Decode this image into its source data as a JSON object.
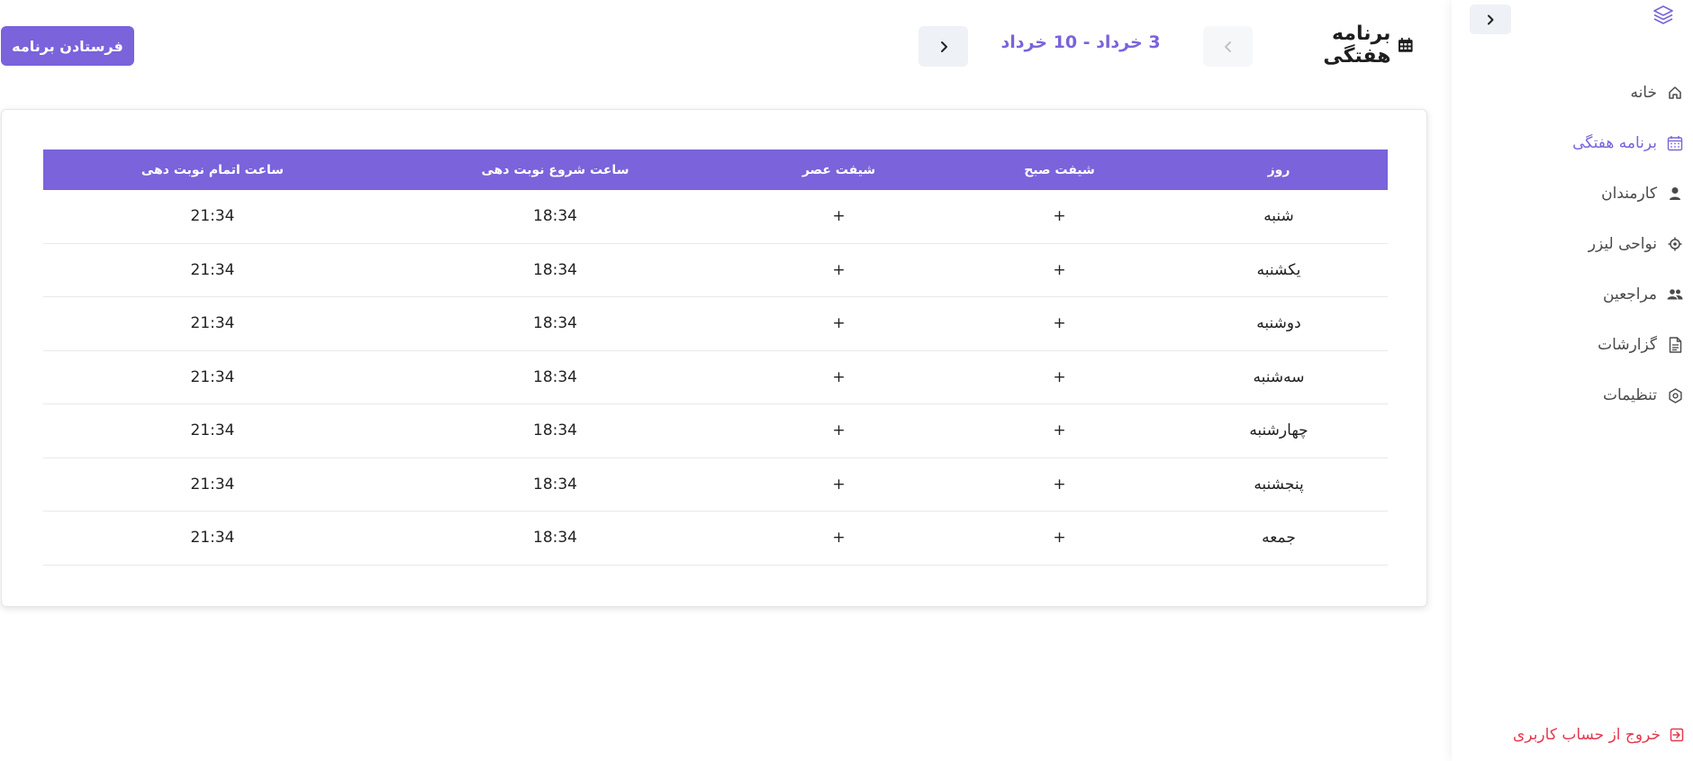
{
  "header": {
    "title": "برنامه هفتگی",
    "week_range": "3 خرداد - 10 خرداد",
    "send_label": "فرستادن برنامه"
  },
  "table": {
    "columns": [
      "روز",
      "شیفت صبح",
      "شیفت عصر",
      "ساعت شروع نوبت دهی",
      "ساعت اتمام نوبت دهی"
    ],
    "rows": [
      {
        "day": "شنبه",
        "morning": "+",
        "evening": "+",
        "start": "18:34",
        "end": "21:34"
      },
      {
        "day": "یکشنبه",
        "morning": "+",
        "evening": "+",
        "start": "18:34",
        "end": "21:34"
      },
      {
        "day": "دوشنبه",
        "morning": "+",
        "evening": "+",
        "start": "18:34",
        "end": "21:34"
      },
      {
        "day": "سه‌شنبه",
        "morning": "+",
        "evening": "+",
        "start": "18:34",
        "end": "21:34"
      },
      {
        "day": "چهارشنبه",
        "morning": "+",
        "evening": "+",
        "start": "18:34",
        "end": "21:34"
      },
      {
        "day": "پنجشنبه",
        "morning": "+",
        "evening": "+",
        "start": "18:34",
        "end": "21:34"
      },
      {
        "day": "جمعه",
        "morning": "+",
        "evening": "+",
        "start": "18:34",
        "end": "21:34"
      }
    ]
  },
  "sidebar": {
    "items": [
      {
        "label": "خانه",
        "icon": "home-icon"
      },
      {
        "label": "برنامه هفتگی",
        "icon": "calendar-icon",
        "active": true
      },
      {
        "label": "کارمندان",
        "icon": "user-icon"
      },
      {
        "label": "نواحی لیزر",
        "icon": "target-icon"
      },
      {
        "label": "مراجعین",
        "icon": "users-icon"
      },
      {
        "label": "گزارشات",
        "icon": "document-icon"
      },
      {
        "label": "تنظیمات",
        "icon": "gear-icon"
      }
    ],
    "logout_label": "خروج از حساب کاربری"
  },
  "colors": {
    "accent": "#7a63db",
    "danger": "#e53950",
    "header_text": "#ffffff"
  }
}
